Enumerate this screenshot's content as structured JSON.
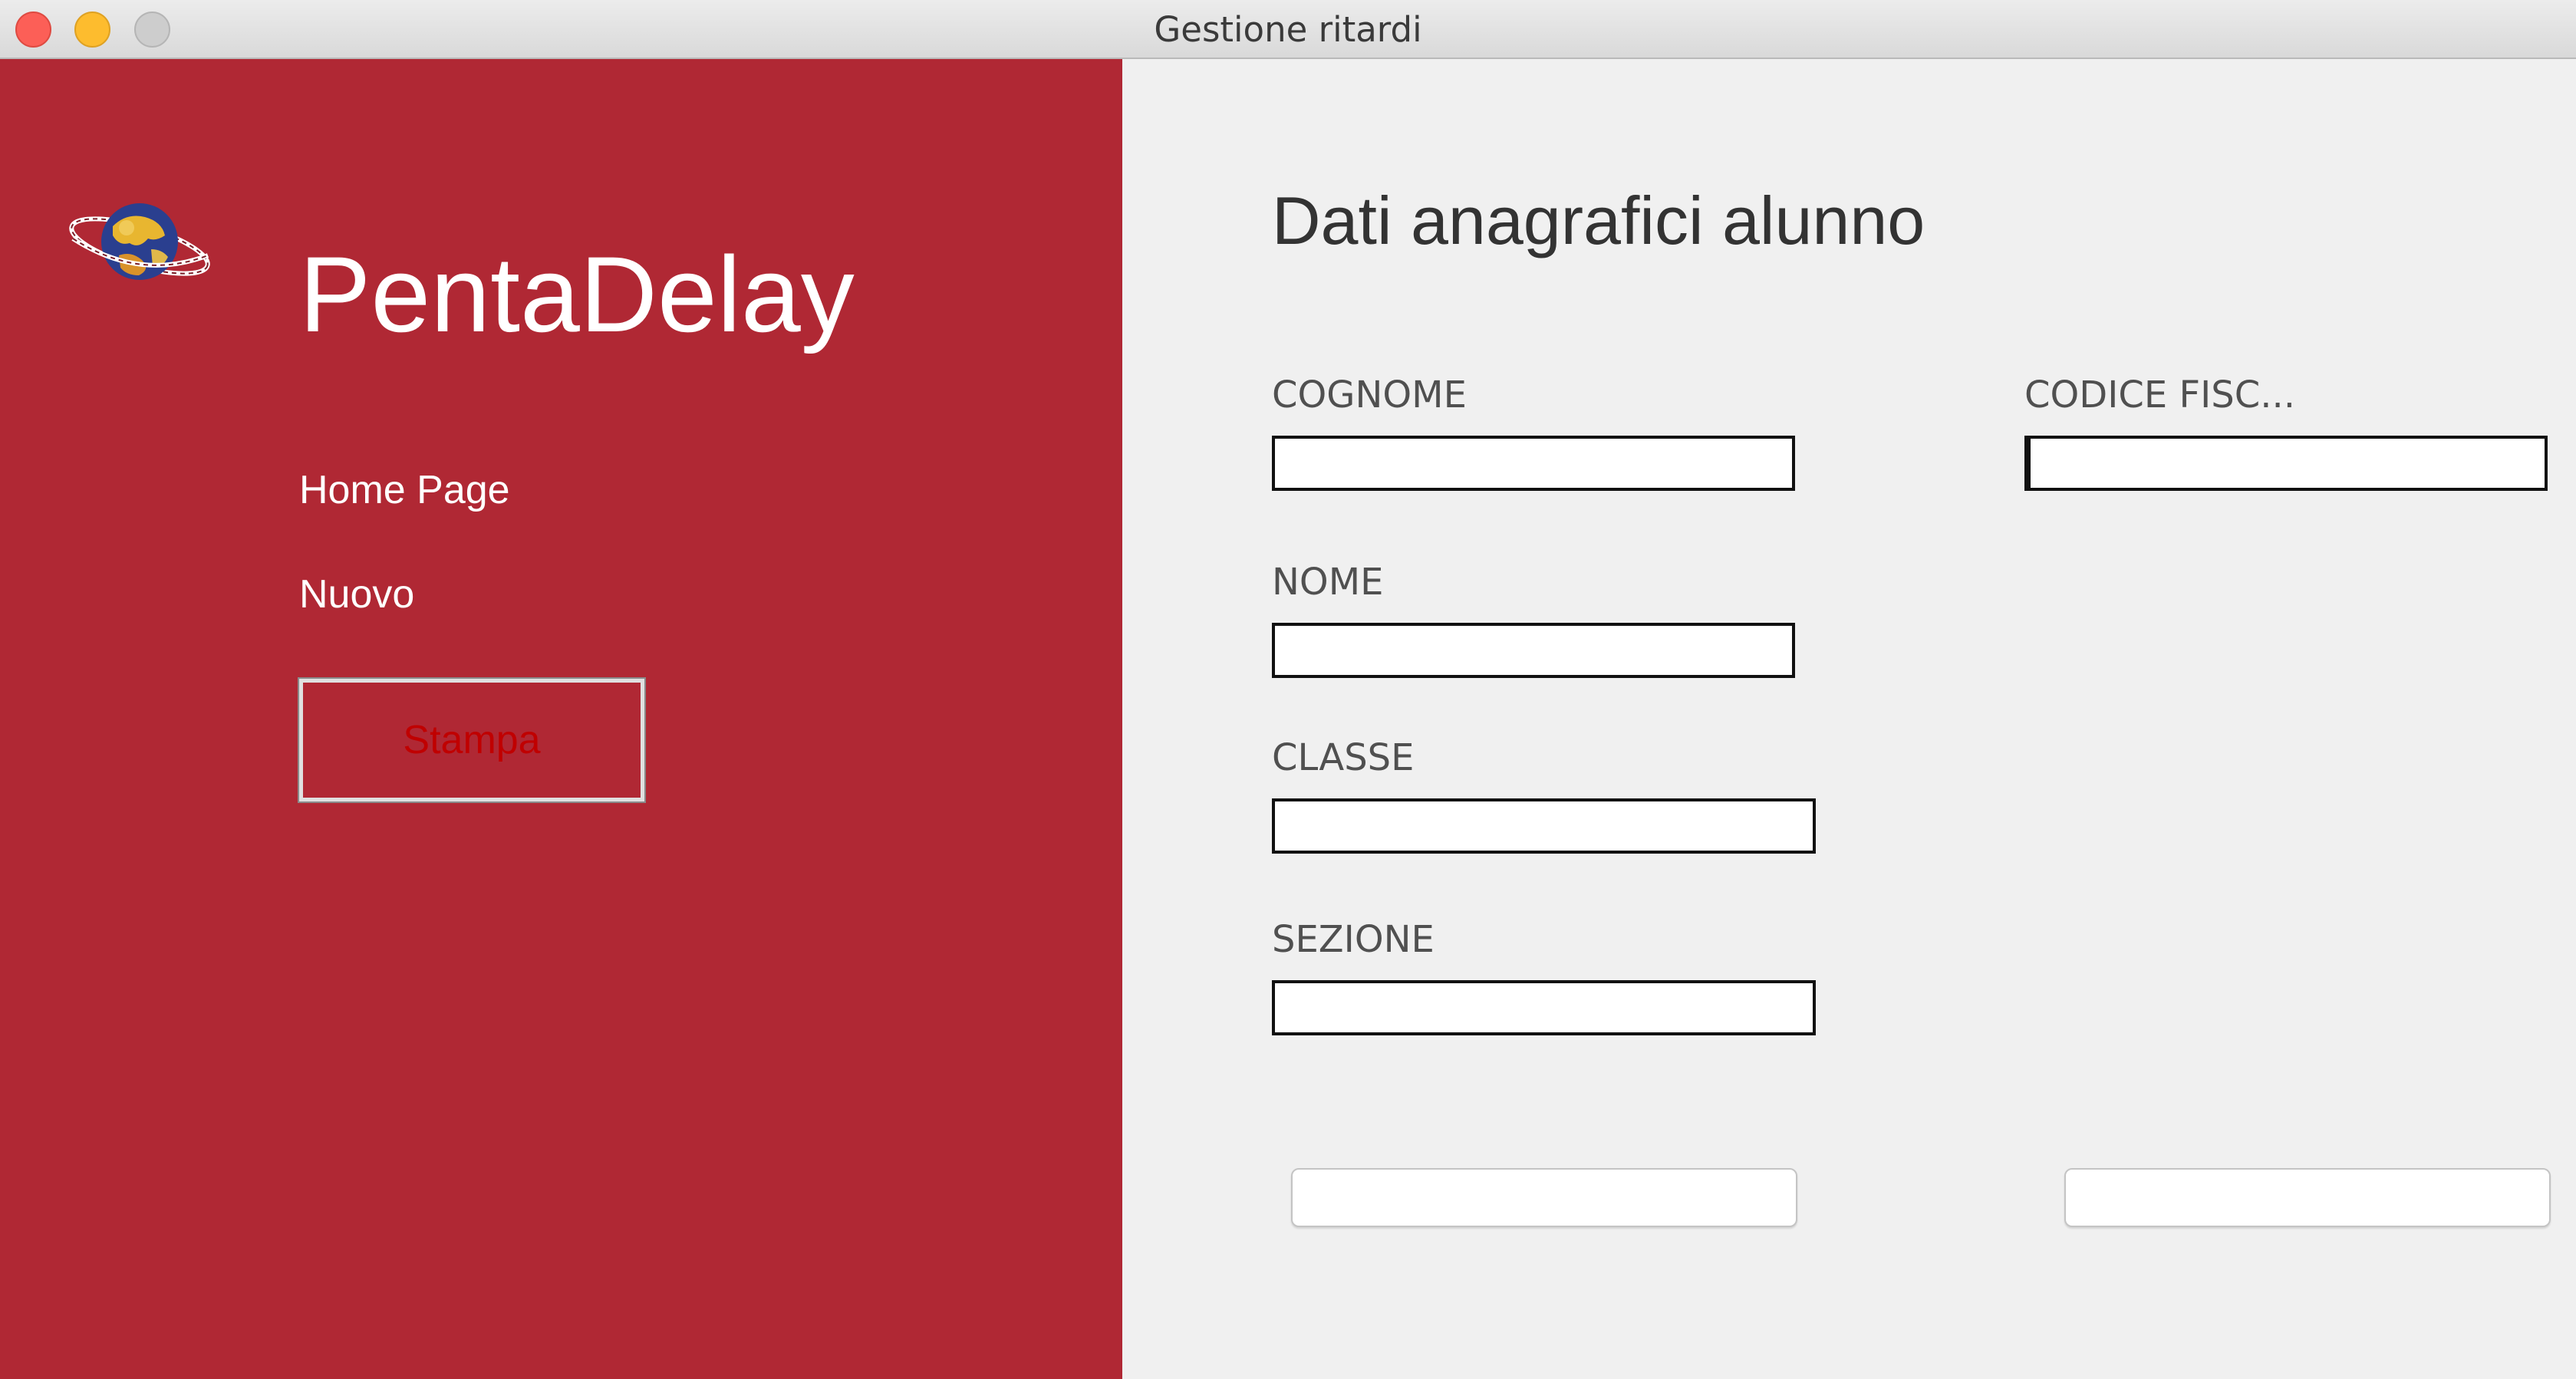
{
  "window": {
    "title": "Gestione ritardi"
  },
  "sidebar": {
    "app_name": "PentaDelay",
    "logo_icon": "planet-globe-icon",
    "nav": [
      {
        "label": "Home Page"
      },
      {
        "label": "Nuovo"
      }
    ],
    "print_button_label": "Stampa"
  },
  "form": {
    "title": "Dati anagrafici alunno",
    "fields": {
      "cognome": {
        "label": "COGNOME",
        "value": ""
      },
      "codice_fiscale": {
        "label": "CODICE FISC...",
        "value": ""
      },
      "nome": {
        "label": "NOME",
        "value": ""
      },
      "classe": {
        "label": "CLASSE",
        "value": ""
      },
      "sezione": {
        "label": "SEZIONE",
        "value": ""
      }
    },
    "buttons": {
      "left_label": "",
      "right_label": ""
    }
  },
  "colors": {
    "sidebar_bg": "#b02834",
    "main_bg": "#f0f0f0",
    "print_label": "#c00000"
  }
}
